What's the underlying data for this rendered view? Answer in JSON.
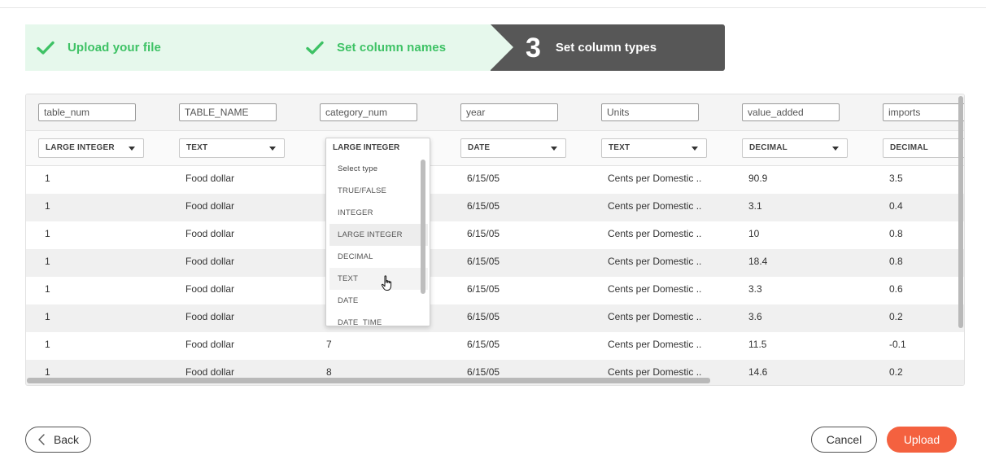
{
  "stepper": {
    "steps": [
      {
        "label": "Upload your file",
        "state": "done"
      },
      {
        "label": "Set column names",
        "state": "done"
      },
      {
        "number": "3",
        "label": "Set column types",
        "state": "active"
      }
    ]
  },
  "colors": {
    "accent_green": "#3ec265",
    "stepper_done_bg": "#e6f8ec",
    "stepper_active_bg": "#575757",
    "primary_button": "#f4613f"
  },
  "columns": [
    {
      "name": "table_num",
      "type": "LARGE INTEGER"
    },
    {
      "name": "TABLE_NAME",
      "type": "TEXT"
    },
    {
      "name": "category_num",
      "type": "LARGE INTEGER"
    },
    {
      "name": "year",
      "type": "DATE"
    },
    {
      "name": "Units",
      "type": "TEXT"
    },
    {
      "name": "value_added",
      "type": "DECIMAL"
    },
    {
      "name": "imports",
      "type": "DECIMAL"
    }
  ],
  "rows": [
    [
      "1",
      "Food dollar",
      "",
      "6/15/05",
      "Cents per Domestic ..",
      "90.9",
      "3.5"
    ],
    [
      "1",
      "Food dollar",
      "",
      "6/15/05",
      "Cents per Domestic ..",
      "3.1",
      "0.4"
    ],
    [
      "1",
      "Food dollar",
      "",
      "6/15/05",
      "Cents per Domestic ..",
      "10",
      "0.8"
    ],
    [
      "1",
      "Food dollar",
      "",
      "6/15/05",
      "Cents per Domestic ..",
      "18.4",
      "0.8"
    ],
    [
      "1",
      "Food dollar",
      "",
      "6/15/05",
      "Cents per Domestic ..",
      "3.3",
      "0.6"
    ],
    [
      "1",
      "Food dollar",
      "",
      "6/15/05",
      "Cents per Domestic ..",
      "3.6",
      "0.2"
    ],
    [
      "1",
      "Food dollar",
      "7",
      "6/15/05",
      "Cents per Domestic ..",
      "11.5",
      "-0.1"
    ],
    [
      "1",
      "Food dollar",
      "8",
      "6/15/05",
      "Cents per Domestic ..",
      "14.6",
      "0.2"
    ]
  ],
  "dropdown": {
    "current": "LARGE INTEGER",
    "options": [
      "Select type",
      "TRUE/FALSE",
      "INTEGER",
      "LARGE INTEGER",
      "DECIMAL",
      "TEXT",
      "DATE",
      "DATE_TIME"
    ],
    "selected": "LARGE INTEGER",
    "hovered": "TEXT"
  },
  "footer": {
    "back_label": "Back",
    "cancel_label": "Cancel",
    "upload_label": "Upload"
  },
  "icons": {
    "step_done": "check-icon",
    "back": "chevron-left-icon",
    "select_caret": "caret-down-icon",
    "pointer": "hand-pointer-icon"
  }
}
